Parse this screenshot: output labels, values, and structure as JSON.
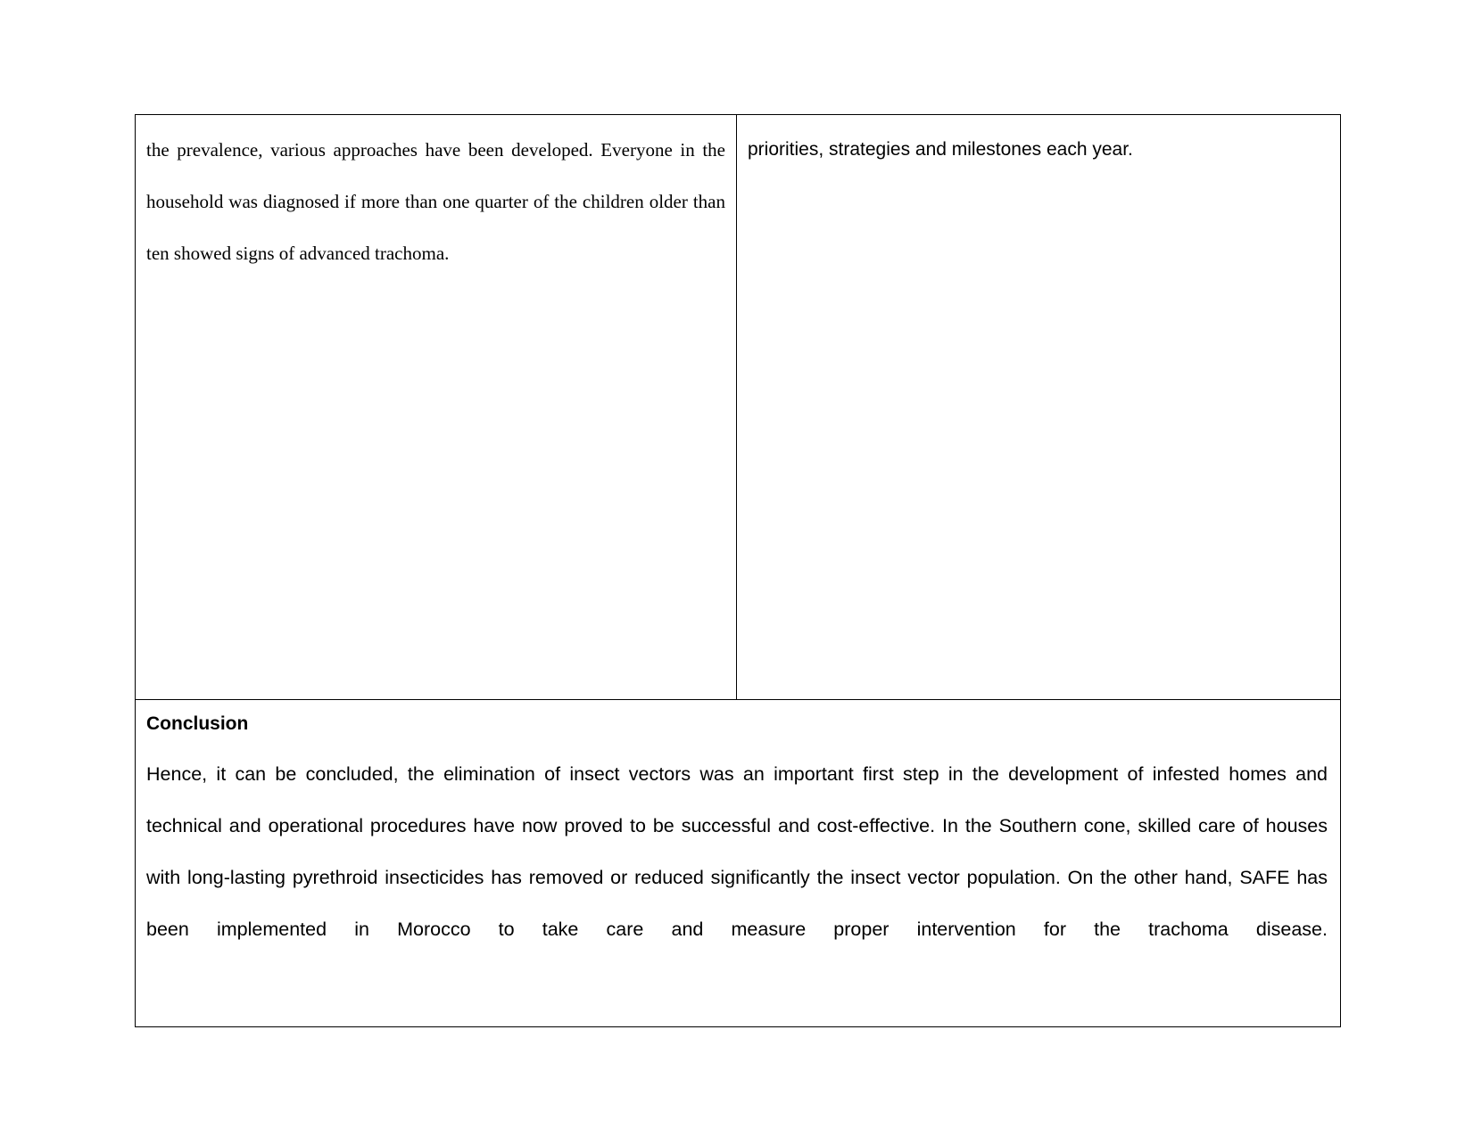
{
  "document": {
    "table": {
      "row_one": {
        "left_cell": {
          "paragraph": "the prevalence, various approaches have been developed. Everyone in the household was diagnosed if more than one quarter of the children older than ten showed signs of advanced trachoma."
        },
        "right_cell": {
          "paragraph": "priorities, strategies and milestones each year."
        }
      },
      "row_two": {
        "merged_cell": {
          "heading": "Conclusion",
          "paragraph": "Hence, it can be concluded, the elimination of insect vectors was an important first step in the development of infested homes and technical and operational procedures have now proved to be successful and cost-effective. In the Southern cone, skilled care of houses with long-lasting pyrethroid insecticides has removed or reduced significantly the insect vector population. On the other hand, SAFE has been implemented in Morocco to take care and measure proper intervention for the trachoma disease."
        }
      }
    }
  },
  "colors": {
    "page_background": "#ffffff",
    "text": "#000000",
    "table_border": "#000000"
  }
}
